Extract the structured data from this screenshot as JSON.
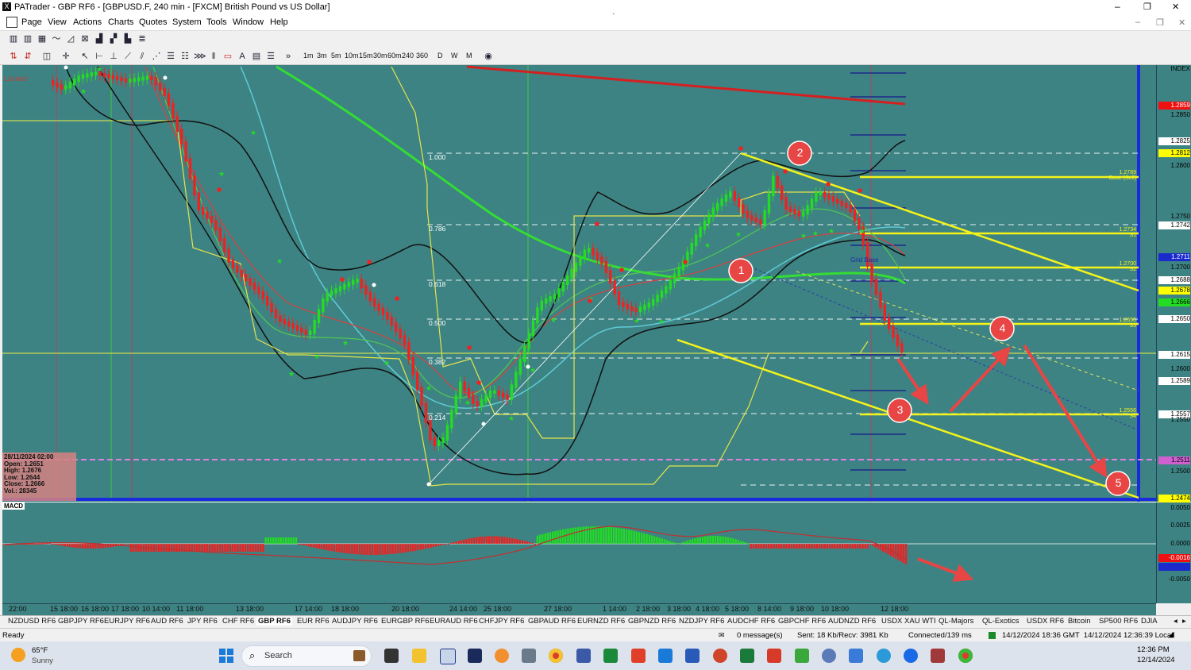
{
  "window": {
    "title": "PATrader - GBP RF6 - [GBPUSD.F, 240 min - [FXCM] British Pound vs US Dollar]",
    "min_label": "–",
    "max_label": "❐",
    "close_label": "✕"
  },
  "menu": [
    "Page",
    "View",
    "Actions",
    "Charts",
    "Quotes",
    "System",
    "Tools",
    "Window",
    "Help"
  ],
  "timeframes": [
    "1m",
    "3m",
    "5m",
    "10m",
    "15m",
    "30m",
    "60m",
    "240",
    "360",
    "D",
    "W",
    "M"
  ],
  "chart": {
    "locked_label": "Locked",
    "fib_labels": [
      "1.000",
      "0.786",
      "0.618",
      "0.500",
      "0.382",
      "0.214"
    ],
    "level_labels": [
      {
        "name": "1.2789",
        "sub": "Base (Sell)"
      },
      {
        "name": "1.2734",
        "sub": "S1"
      },
      {
        "name": "1.2700",
        "sub": "S2"
      },
      {
        "name": "1.2650",
        "sub": "S3"
      },
      {
        "name": "1.2556",
        "sub": "S4"
      }
    ],
    "grid_base_label": "Grid Base",
    "callouts": [
      "1",
      "2",
      "3",
      "4",
      "5"
    ],
    "ohlc": {
      "date": "28/11/2024 02:00",
      "open": "Open: 1.2651",
      "high": "High: 1.2676",
      "low": "Low: 1.2644",
      "close": "Close: 1.2666",
      "vol": "Vol.: 28345"
    },
    "price_labels": [
      {
        "text": "INDEX",
        "color": "#111"
      },
      {
        "text": "1.2859",
        "color": "#e11"
      },
      {
        "text": "1.2850",
        "color": "#111"
      },
      {
        "text": "1.2825",
        "color": "#fff"
      },
      {
        "text": "1.2812",
        "color": "#ff0"
      },
      {
        "text": "1.2800",
        "color": "#111"
      },
      {
        "text": "1.2750",
        "color": "#111"
      },
      {
        "text": "1.2742",
        "color": "#fff"
      },
      {
        "text": "1.2711",
        "color": "#1a2acc"
      },
      {
        "text": "1.2700",
        "color": "#111"
      },
      {
        "text": "1.2688",
        "color": "#fff"
      },
      {
        "text": "1.2678",
        "color": "#ff0"
      },
      {
        "text": "1.2666",
        "color": "#22dd22"
      },
      {
        "text": "1.2650",
        "color": "#fff"
      },
      {
        "text": "1.2615",
        "color": "#fff"
      },
      {
        "text": "1.2600",
        "color": "#111"
      },
      {
        "text": "1.2589",
        "color": "#fff"
      },
      {
        "text": "1.2557",
        "color": "#fff"
      },
      {
        "text": "1.2550",
        "color": "#111"
      },
      {
        "text": "1.2511",
        "color": "#d060d0"
      },
      {
        "text": "1.2500",
        "color": "#111"
      },
      {
        "text": "1.2474",
        "color": "#ff0"
      }
    ]
  },
  "macd": {
    "label": "MACD",
    "scale": [
      "0.0050",
      "0.0025",
      "0.0000",
      "-0.0016",
      "-0.0025",
      "-0.0050"
    ]
  },
  "time_axis": [
    "22:00",
    "15 18:00",
    "16 18:00",
    "17 18:00",
    "10 14:00",
    "11 18:00",
    "13 18:00",
    "17 14:00",
    "18 18:00",
    "20 18:00",
    "24 14:00",
    "25 18:00",
    "27 18:00",
    "1 14:00",
    "2 18:00",
    "3 18:00",
    "4 18:00",
    "5 18:00",
    "8 14:00",
    "9 18:00",
    "10 18:00",
    "12 18:00"
  ],
  "symbol_tabs": [
    "NZDUSD RF6",
    "GBPJPY RF6",
    "EURJPY RF6",
    "AUD RF6",
    "JPY RF6",
    "CHF RF6",
    "GBP RF6",
    "EUR RF6",
    "AUDJPY RF6",
    "EURGBP RF6",
    "EURAUD RF6",
    "CHFJPY RF6",
    "GBPAUD RF6",
    "EURNZD RF6",
    "GBPNZD RF6",
    "NZDJPY RF6",
    "AUDCHF RF6",
    "GBPCHF RF6",
    "AUDNZD RF6",
    "USDX XAU WTI",
    "QL-Majors",
    "QL-Exotics",
    "USDX RF6",
    "Bitcoin",
    "SP500 RF6",
    "DJIA"
  ],
  "active_tab": "GBP RF6",
  "status": {
    "ready": "Ready",
    "messages": "0 message(s)",
    "traffic": "Sent: 18 Kb/Recv: 3981 Kb",
    "connection": "Connected/139 ms",
    "clock": "14/12/2024 18:36 GMT  14/12/2024 12:36:39 Local"
  },
  "taskbar": {
    "weather_temp": "65°F",
    "weather_desc": "Sunny",
    "search_placeholder": "Search",
    "time": "12:36 PM",
    "date": "12/14/2024"
  }
}
